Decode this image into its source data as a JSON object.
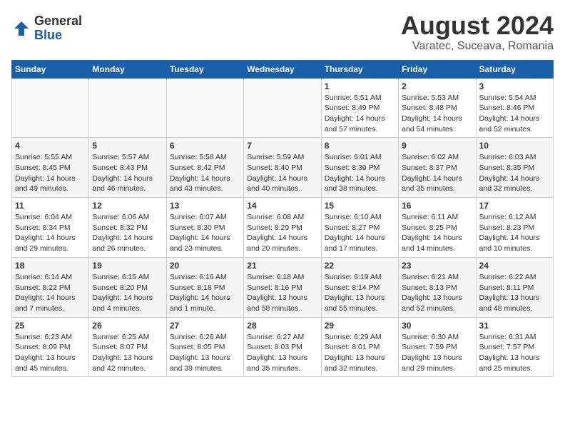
{
  "header": {
    "logo_general": "General",
    "logo_blue": "Blue",
    "month_year": "August 2024",
    "location": "Varatec, Suceava, Romania"
  },
  "days_of_week": [
    "Sunday",
    "Monday",
    "Tuesday",
    "Wednesday",
    "Thursday",
    "Friday",
    "Saturday"
  ],
  "weeks": [
    [
      {
        "day": "",
        "info": ""
      },
      {
        "day": "",
        "info": ""
      },
      {
        "day": "",
        "info": ""
      },
      {
        "day": "",
        "info": ""
      },
      {
        "day": "1",
        "info": "Sunrise: 5:51 AM\nSunset: 8:49 PM\nDaylight: 14 hours\nand 57 minutes."
      },
      {
        "day": "2",
        "info": "Sunrise: 5:53 AM\nSunset: 8:48 PM\nDaylight: 14 hours\nand 54 minutes."
      },
      {
        "day": "3",
        "info": "Sunrise: 5:54 AM\nSunset: 8:46 PM\nDaylight: 14 hours\nand 52 minutes."
      }
    ],
    [
      {
        "day": "4",
        "info": "Sunrise: 5:55 AM\nSunset: 8:45 PM\nDaylight: 14 hours\nand 49 minutes."
      },
      {
        "day": "5",
        "info": "Sunrise: 5:57 AM\nSunset: 8:43 PM\nDaylight: 14 hours\nand 46 minutes."
      },
      {
        "day": "6",
        "info": "Sunrise: 5:58 AM\nSunset: 8:42 PM\nDaylight: 14 hours\nand 43 minutes."
      },
      {
        "day": "7",
        "info": "Sunrise: 5:59 AM\nSunset: 8:40 PM\nDaylight: 14 hours\nand 40 minutes."
      },
      {
        "day": "8",
        "info": "Sunrise: 6:01 AM\nSunset: 8:39 PM\nDaylight: 14 hours\nand 38 minutes."
      },
      {
        "day": "9",
        "info": "Sunrise: 6:02 AM\nSunset: 8:37 PM\nDaylight: 14 hours\nand 35 minutes."
      },
      {
        "day": "10",
        "info": "Sunrise: 6:03 AM\nSunset: 8:35 PM\nDaylight: 14 hours\nand 32 minutes."
      }
    ],
    [
      {
        "day": "11",
        "info": "Sunrise: 6:04 AM\nSunset: 8:34 PM\nDaylight: 14 hours\nand 29 minutes."
      },
      {
        "day": "12",
        "info": "Sunrise: 6:06 AM\nSunset: 8:32 PM\nDaylight: 14 hours\nand 26 minutes."
      },
      {
        "day": "13",
        "info": "Sunrise: 6:07 AM\nSunset: 8:30 PM\nDaylight: 14 hours\nand 23 minutes."
      },
      {
        "day": "14",
        "info": "Sunrise: 6:08 AM\nSunset: 8:29 PM\nDaylight: 14 hours\nand 20 minutes."
      },
      {
        "day": "15",
        "info": "Sunrise: 6:10 AM\nSunset: 8:27 PM\nDaylight: 14 hours\nand 17 minutes."
      },
      {
        "day": "16",
        "info": "Sunrise: 6:11 AM\nSunset: 8:25 PM\nDaylight: 14 hours\nand 14 minutes."
      },
      {
        "day": "17",
        "info": "Sunrise: 6:12 AM\nSunset: 8:23 PM\nDaylight: 14 hours\nand 10 minutes."
      }
    ],
    [
      {
        "day": "18",
        "info": "Sunrise: 6:14 AM\nSunset: 8:22 PM\nDaylight: 14 hours\nand 7 minutes."
      },
      {
        "day": "19",
        "info": "Sunrise: 6:15 AM\nSunset: 8:20 PM\nDaylight: 14 hours\nand 4 minutes."
      },
      {
        "day": "20",
        "info": "Sunrise: 6:16 AM\nSunset: 8:18 PM\nDaylight: 14 hours\nand 1 minute."
      },
      {
        "day": "21",
        "info": "Sunrise: 6:18 AM\nSunset: 8:16 PM\nDaylight: 13 hours\nand 58 minutes."
      },
      {
        "day": "22",
        "info": "Sunrise: 6:19 AM\nSunset: 8:14 PM\nDaylight: 13 hours\nand 55 minutes."
      },
      {
        "day": "23",
        "info": "Sunrise: 6:21 AM\nSunset: 8:13 PM\nDaylight: 13 hours\nand 52 minutes."
      },
      {
        "day": "24",
        "info": "Sunrise: 6:22 AM\nSunset: 8:11 PM\nDaylight: 13 hours\nand 48 minutes."
      }
    ],
    [
      {
        "day": "25",
        "info": "Sunrise: 6:23 AM\nSunset: 8:09 PM\nDaylight: 13 hours\nand 45 minutes."
      },
      {
        "day": "26",
        "info": "Sunrise: 6:25 AM\nSunset: 8:07 PM\nDaylight: 13 hours\nand 42 minutes."
      },
      {
        "day": "27",
        "info": "Sunrise: 6:26 AM\nSunset: 8:05 PM\nDaylight: 13 hours\nand 39 minutes."
      },
      {
        "day": "28",
        "info": "Sunrise: 6:27 AM\nSunset: 8:03 PM\nDaylight: 13 hours\nand 35 minutes."
      },
      {
        "day": "29",
        "info": "Sunrise: 6:29 AM\nSunset: 8:01 PM\nDaylight: 13 hours\nand 32 minutes."
      },
      {
        "day": "30",
        "info": "Sunrise: 6:30 AM\nSunset: 7:59 PM\nDaylight: 13 hours\nand 29 minutes."
      },
      {
        "day": "31",
        "info": "Sunrise: 6:31 AM\nSunset: 7:57 PM\nDaylight: 13 hours\nand 25 minutes."
      }
    ]
  ]
}
